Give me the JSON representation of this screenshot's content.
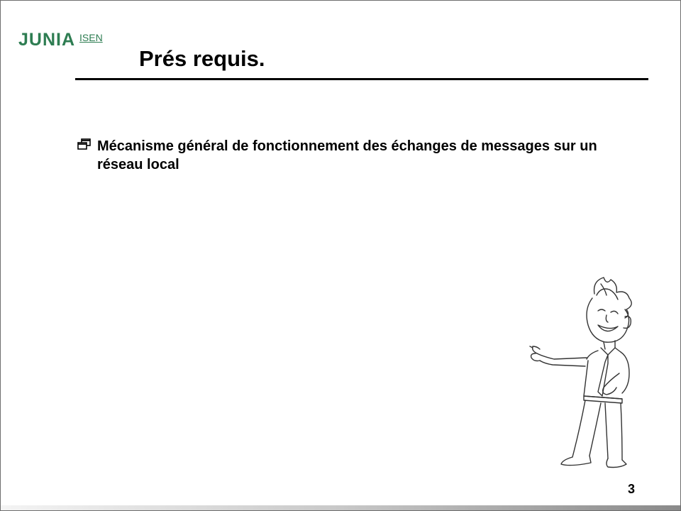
{
  "logo": {
    "junia": "JUNIA",
    "isen": "ISEN",
    "color": "#2e7d52"
  },
  "slide": {
    "title": "Prés requis.",
    "bullets": [
      {
        "icon": "window-restore-icon",
        "text": "Mécanisme général de fonctionnement des échanges de messages sur un réseau local"
      }
    ],
    "page_number": "3"
  }
}
